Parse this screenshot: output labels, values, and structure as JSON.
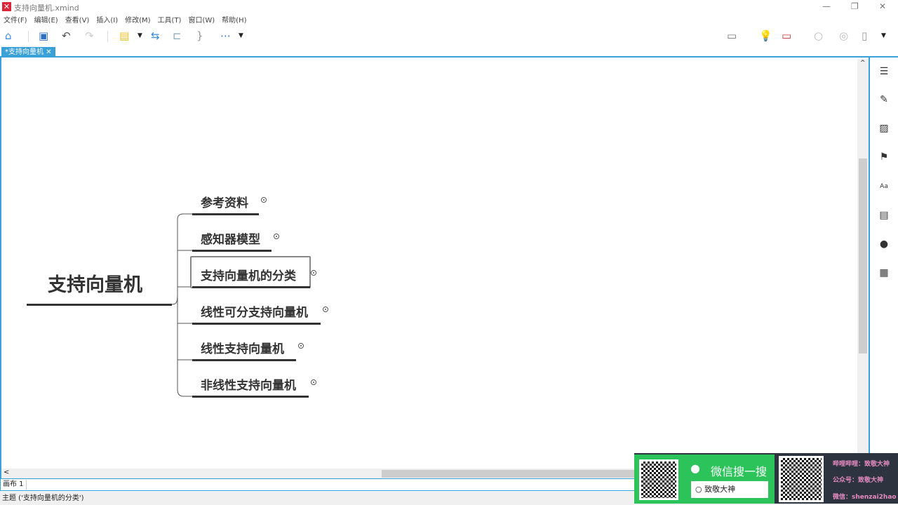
{
  "window": {
    "title": "支持向量机.xmind",
    "minimize": "—",
    "restore": "❐",
    "close": "✕"
  },
  "menu": [
    "文件(F)",
    "编辑(E)",
    "查看(V)",
    "插入(I)",
    "修改(M)",
    "工具(T)",
    "窗口(W)",
    "帮助(H)"
  ],
  "tab": {
    "label": "*支持向量机",
    "close": "✕"
  },
  "map": {
    "central": "支持向量机",
    "topics": [
      "参考资料",
      "感知器模型",
      "支持向量机的分类",
      "线性可分支持向量机",
      "线性支持向量机",
      "非线性支持向量机"
    ],
    "selected_index": 2
  },
  "sheet": {
    "label": "画布 1"
  },
  "status": "主题 ('支持向量机的分类')",
  "scroll_left": "<",
  "scroll_up": "^",
  "ad": {
    "search_title": "微信搜一搜",
    "search_value": "致敬大神",
    "line1": "哔哩哔哩：致敬大神",
    "line2": "公众号：致敬大神",
    "line3": "微信：shenzai2hao"
  }
}
